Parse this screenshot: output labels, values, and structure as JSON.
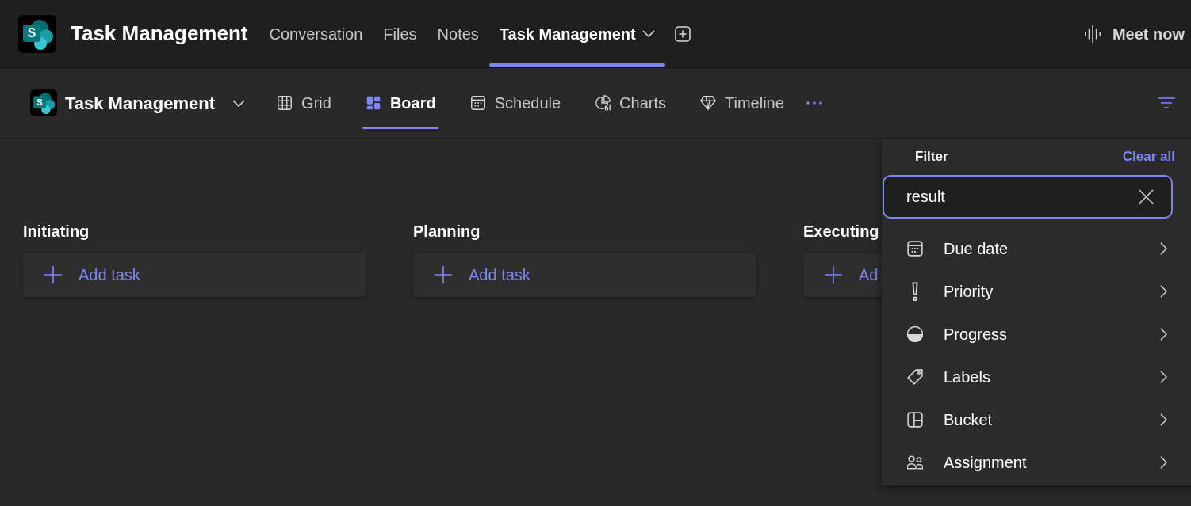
{
  "app": {
    "logo_letter": "S",
    "title": "Task Management"
  },
  "nav_tabs": [
    {
      "label": "Conversation",
      "selected": false,
      "dropdown": false
    },
    {
      "label": "Files",
      "selected": false,
      "dropdown": false
    },
    {
      "label": "Notes",
      "selected": false,
      "dropdown": false
    },
    {
      "label": "Task Management",
      "selected": true,
      "dropdown": true
    }
  ],
  "meet_now": "Meet now",
  "plan": {
    "logo_letter": "S",
    "title": "Task Management"
  },
  "views": [
    {
      "label": "Grid",
      "kind": "grid",
      "selected": false
    },
    {
      "label": "Board",
      "kind": "board",
      "selected": true
    },
    {
      "label": "Schedule",
      "kind": "schedule",
      "selected": false
    },
    {
      "label": "Charts",
      "kind": "charts",
      "selected": false
    },
    {
      "label": "Timeline",
      "kind": "timeline",
      "selected": false
    }
  ],
  "buckets": [
    {
      "title": "Initiating",
      "add_label": "Add task"
    },
    {
      "title": "Planning",
      "add_label": "Add task"
    },
    {
      "title": "Executing",
      "add_label": "Ad"
    }
  ],
  "filter": {
    "title": "Filter",
    "clear": "Clear all",
    "search": {
      "value": "result"
    },
    "items": [
      {
        "label": "Due date",
        "kind": "calendar"
      },
      {
        "label": "Priority",
        "kind": "priority"
      },
      {
        "label": "Progress",
        "kind": "progress"
      },
      {
        "label": "Labels",
        "kind": "tag"
      },
      {
        "label": "Bucket",
        "kind": "bucket"
      },
      {
        "label": "Assignment",
        "kind": "people"
      }
    ]
  }
}
